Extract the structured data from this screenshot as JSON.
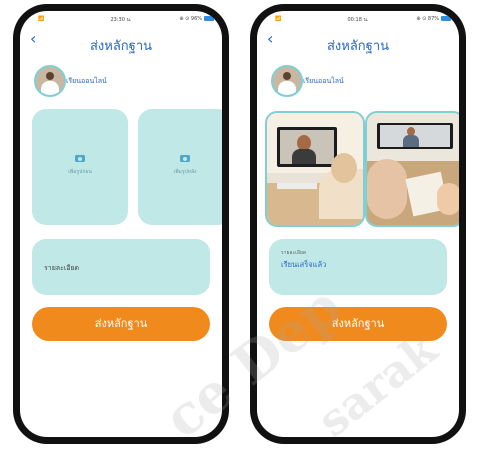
{
  "left_screen": {
    "status": {
      "signal": "📶",
      "time": "23:30 น.",
      "battery_text": "⊕ ⊙ 96%"
    },
    "header": {
      "back_icon": "‹",
      "title": "ส่งหลักฐาน"
    },
    "user": {
      "name": "เรียนออนไลน์"
    },
    "upload": {
      "front_caption": "เพิ่มรูปก่อน",
      "back_caption": "เพิ่มรูปหลัง"
    },
    "detail": {
      "placeholder": "รายละเอียด"
    },
    "submit_label": "ส่งหลักฐาน"
  },
  "right_screen": {
    "status": {
      "signal": "📶",
      "time": "00:18 น.",
      "battery_text": "⊕ ⊙ 87%"
    },
    "header": {
      "back_icon": "‹",
      "title": "ส่งหลักฐาน"
    },
    "user": {
      "name": "เรียนออนไลน์"
    },
    "detail": {
      "label": "รายละเอียด",
      "value": "เรียนเสร็จแล้ว"
    },
    "submit_label": "ส่งหลักฐาน"
  },
  "colors": {
    "accent": "#2a66c8",
    "tile": "#bfe8e6",
    "button": "#f08a1c"
  }
}
